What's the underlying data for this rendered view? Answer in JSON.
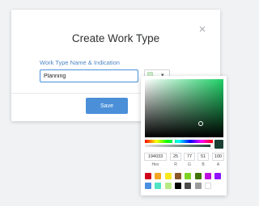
{
  "dialog": {
    "title": "Create Work Type",
    "close_glyph": "×",
    "field_label": "Work Type Name & Indication",
    "name_value": "Planning",
    "color_button_caret": "▾",
    "save_label": "Save"
  },
  "picker": {
    "selected_hex": "194033",
    "r": "25",
    "g": "77",
    "b": "51",
    "a": "100",
    "labels": {
      "hex": "Hex",
      "r": "R",
      "g": "G",
      "b": "B",
      "a": "A"
    },
    "hue_level": 0.42,
    "alpha_level": 1.0,
    "presets_row1": [
      "#d0021b",
      "#f5a623",
      "#f8e71c",
      "#8b572a",
      "#7ed321",
      "#417505",
      "#bd10e0",
      "#9013fe"
    ],
    "presets_row2": [
      "#4a90e2",
      "#50e3c2",
      "#b8e986",
      "#000000",
      "#4a4a4a",
      "#9b9b9b",
      "#ffffff"
    ]
  },
  "colors": {
    "accent": "#4a8fd8",
    "label_blue": "#4f86c6",
    "preview_swatch": "#cfeecd",
    "current_color": "#194033"
  },
  "icons": {
    "close": "close-icon",
    "dropdown": "chevron-down-icon"
  }
}
